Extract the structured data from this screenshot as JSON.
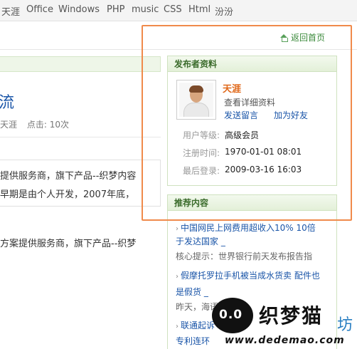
{
  "topnav": {
    "items": [
      "天涯",
      "Office",
      "Windows",
      "PHP",
      "music",
      "CSS",
      "Html",
      "汾汾"
    ]
  },
  "article": {
    "title": "流",
    "author": "天涯",
    "clicks": "点击: 10次",
    "line1": "提供服务商，旗下产品--织梦内容",
    "line2": "早期是由个人开发，2007年底，",
    "line3": "方案提供服务商，旗下产品--织梦"
  },
  "sidebar": {
    "back_home": "返回首页",
    "publisher": {
      "heading": "发布者资料",
      "username": "天涯",
      "view_details": "查看详细资料",
      "send_message": "发送留言",
      "add_friend": "加为好友",
      "level_label": "用户等级:",
      "level_value": "高级会员",
      "reg_label": "注册时间:",
      "reg_value": "1970-01-01 08:01",
      "last_label": "最后登录:",
      "last_value": "2009-03-16 16:03"
    },
    "recommend": {
      "heading": "推荐内容",
      "items": [
        {
          "line1": "中国网民上网费用超收入10% 10倍",
          "line2": "于发达国家 _",
          "summary": "核心提示：世界银行前天发布报告指"
        },
        {
          "line1": "假摩托罗拉手机被当成水货卖 配件也",
          "line2": "是假货 _",
          "summary": "昨天，海语"
        },
        {
          "line1": "联通起诉",
          "line2": "专利连环",
          "summary": ""
        }
      ]
    }
  },
  "watermark": {
    "face": "0.0",
    "name": "织梦猫",
    "url": "www.dedemao.com",
    "fang": "坊"
  }
}
